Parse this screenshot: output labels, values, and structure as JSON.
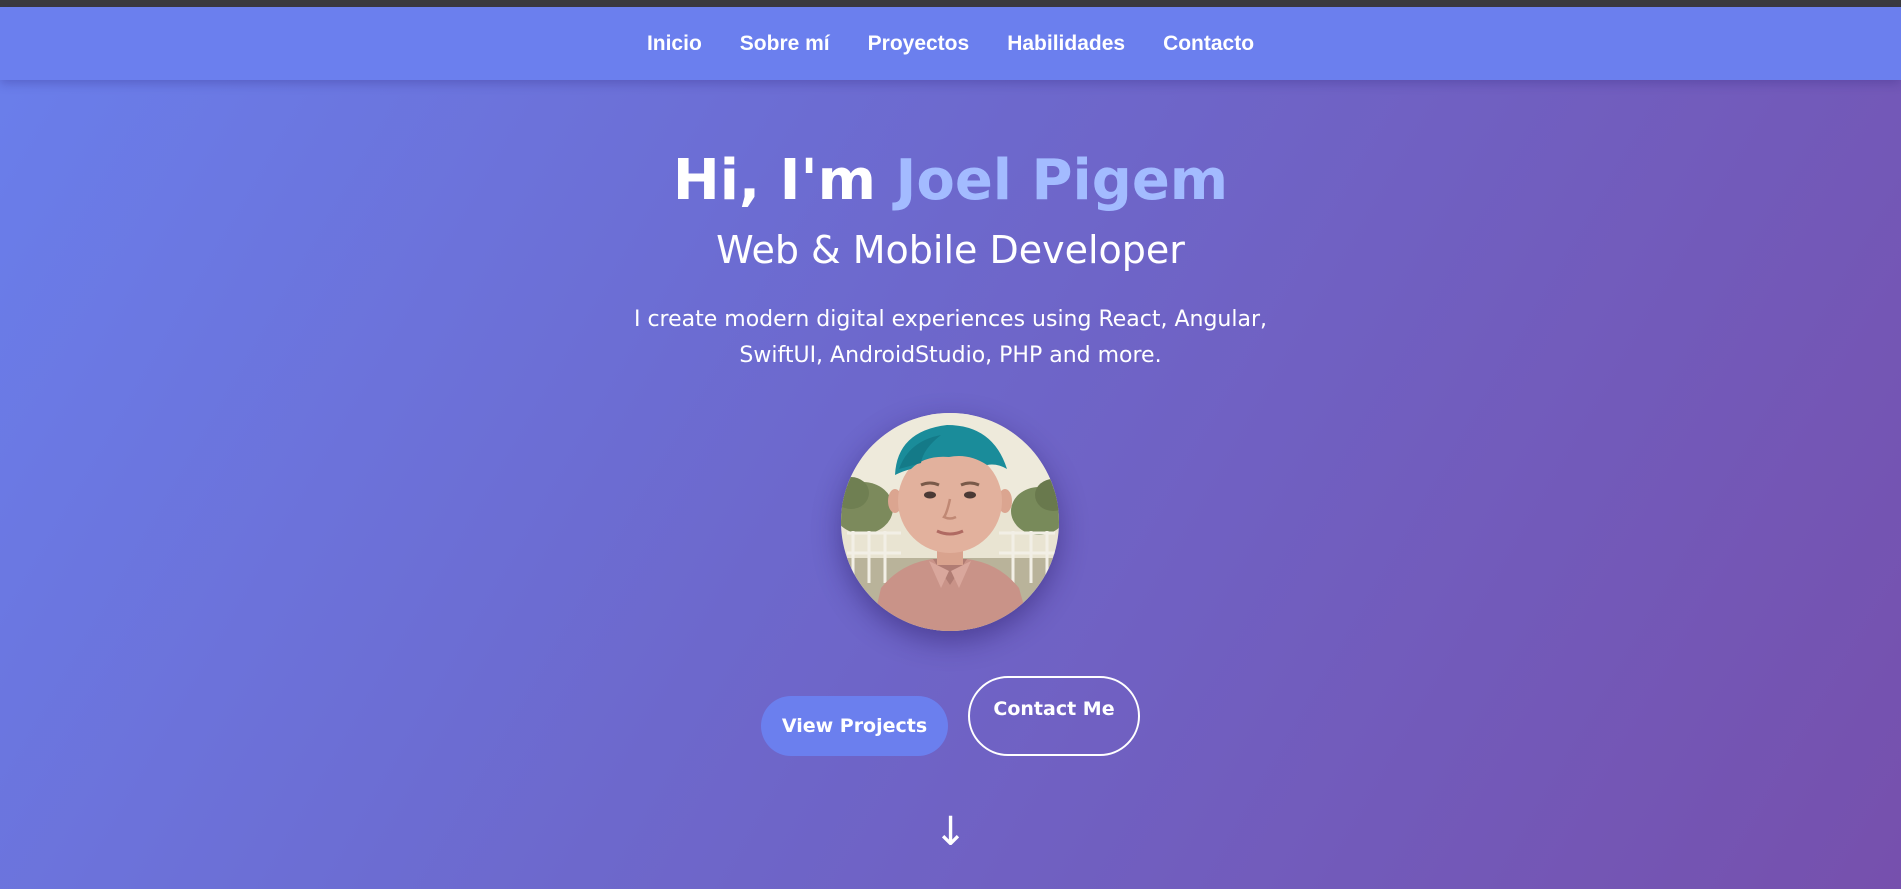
{
  "nav": {
    "items": [
      {
        "label": "Inicio"
      },
      {
        "label": "Sobre mí"
      },
      {
        "label": "Proyectos"
      },
      {
        "label": "Habilidades"
      },
      {
        "label": "Contacto"
      }
    ]
  },
  "hero": {
    "title_prefix": "Hi, I'm ",
    "title_name": "Joel Pigem",
    "subtitle": "Web & Mobile Developer",
    "description": "I create modern digital experiences using React, Angular, SwiftUI, AndroidStudio, PHP and more.",
    "primary_button": "View Projects",
    "secondary_button": "Contact Me",
    "scroll_arrow": "↓"
  },
  "colors": {
    "nav_background": "#6b7fee",
    "name_accent": "#a3bbff",
    "gradient_start": "#6a7fec",
    "gradient_end": "#7650ad"
  },
  "icons": {
    "scroll": "arrow-down-icon",
    "avatar": "profile-photo"
  }
}
